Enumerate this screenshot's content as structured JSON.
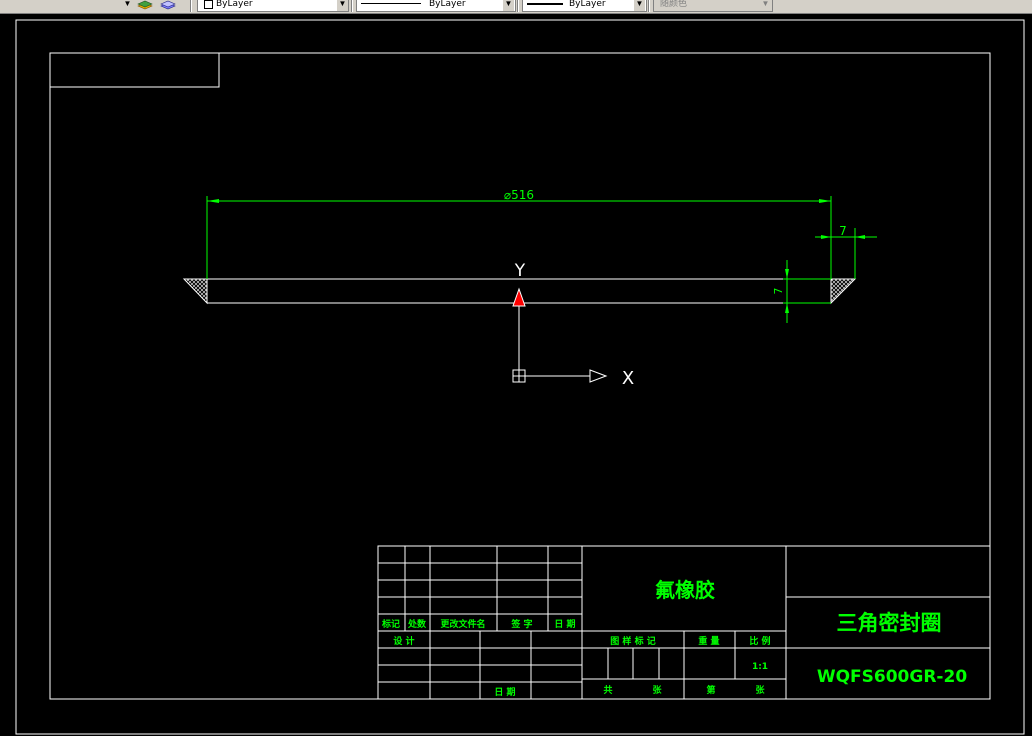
{
  "toolbar": {
    "color_value": "ByLayer",
    "linetype_value": "ByLayer",
    "lineweight_value": "ByLayer",
    "plotstyle_value": "随颜色",
    "layer_icon": "layer-stack-icon",
    "layer_prev_icon": "layer-previous-icon"
  },
  "drawing": {
    "dim_diameter": "⌀516",
    "dim_width": "7",
    "dim_height": "7",
    "ucs_y_label": "Y",
    "ucs_x_label": "X"
  },
  "title_block": {
    "material": "氟橡胶",
    "part_name": "三角密封圈",
    "part_number": "WQFS600GR-20",
    "scale_value": "1:1",
    "hdr_mark": "标记",
    "hdr_count": "处数",
    "hdr_doc": "更改文件名",
    "hdr_sign": "签 字",
    "hdr_date": "日 期",
    "hdr_design": "设 计",
    "hdr_date2": "日 期",
    "hdr_stage": "图 样 标 记",
    "hdr_weight": "重 量",
    "hdr_scale": "比 例",
    "hdr_total": "共",
    "hdr_sheet": "张",
    "hdr_no": "第",
    "hdr_sheet2": "张"
  },
  "colors": {
    "background": "#000000",
    "lines": "#ffffff",
    "dimensions": "#00ff00",
    "text": "#00ff00",
    "toolbar": "#d4d0c8"
  }
}
